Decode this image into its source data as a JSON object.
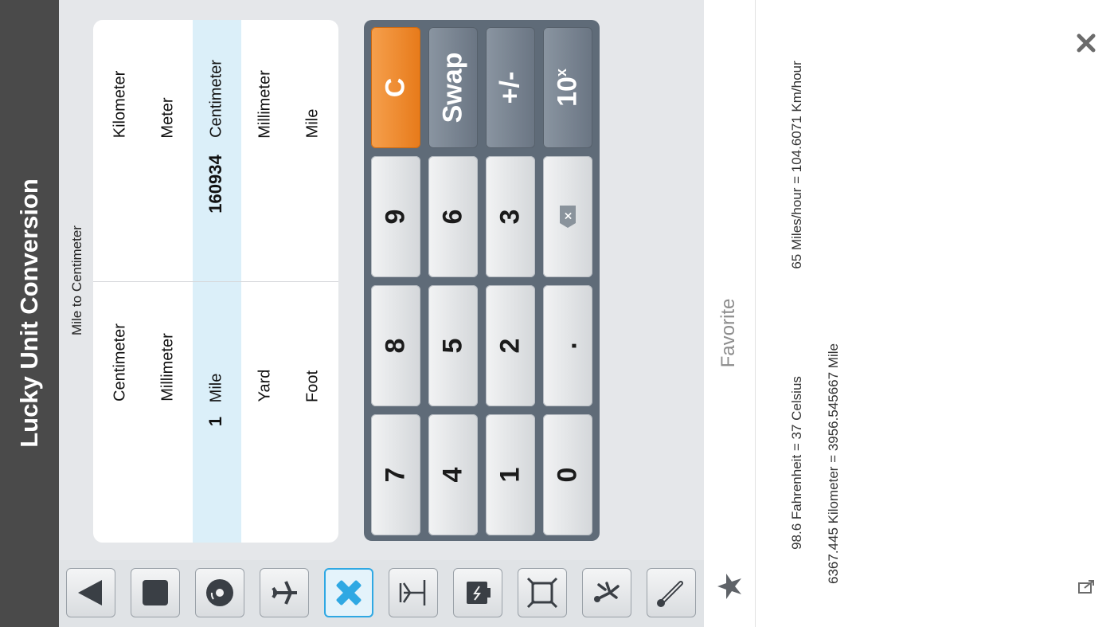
{
  "app": {
    "title": "Lucky Unit Conversion"
  },
  "converter": {
    "subtitle": "Mile to Centimeter",
    "from_units": [
      "Centimeter",
      "Millimeter",
      "Mile",
      "Yard",
      "Foot"
    ],
    "to_units": [
      "Kilometer",
      "Meter",
      "Centimeter",
      "Millimeter",
      "Mile"
    ],
    "from_value": "1",
    "to_value": "160934",
    "selected_from": "Mile",
    "selected_to": "Centimeter"
  },
  "keypad": {
    "keys": {
      "k7": "7",
      "k8": "8",
      "k9": "9",
      "clear": "C",
      "k4": "4",
      "k5": "5",
      "k6": "6",
      "swap": "Swap",
      "k1": "1",
      "k2": "2",
      "k3": "3",
      "sign": "+/-",
      "k0": "0",
      "dot": ".",
      "backspace": "×",
      "exp_base": "10",
      "exp_sup": "x"
    }
  },
  "categories": {
    "items": [
      {
        "icon": "play-icon"
      },
      {
        "icon": "stop-icon"
      },
      {
        "icon": "disc-icon"
      },
      {
        "icon": "airplane-icon"
      },
      {
        "icon": "ruler-pencil-icon",
        "active": true
      },
      {
        "icon": "scale-icon"
      },
      {
        "icon": "battery-icon"
      },
      {
        "icon": "area-icon"
      },
      {
        "icon": "running-icon"
      },
      {
        "icon": "thermometer-icon"
      }
    ]
  },
  "favorites": {
    "title": "Favorite",
    "items": [
      "98.6 Fahrenheit = 37 Celsius",
      "65 Miles/hour = 104.6071 Km/hour",
      "6367.445 Kilometer = 3956.545667 Mile"
    ]
  },
  "colors": {
    "accent": "#2fa8e3",
    "clear_key": "#ef8a2a",
    "title_bar": "#4a4a4a",
    "keypad_bg": "#5f6b78",
    "selected_row": "#dbeff9"
  }
}
